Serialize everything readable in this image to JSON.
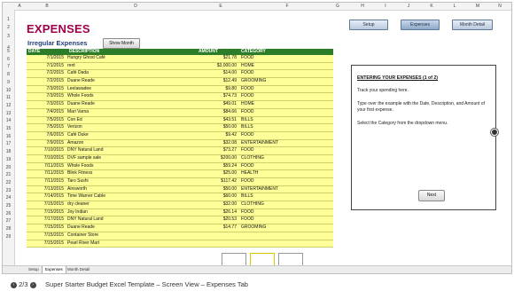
{
  "sheet": {
    "title": "EXPENSES",
    "subtitle": "Irregular Expenses",
    "show_month_button": "Show Month",
    "nav_buttons": [
      {
        "label": "Setup",
        "active": false
      },
      {
        "label": "Expenses",
        "active": true
      },
      {
        "label": "Month Detail",
        "active": false
      }
    ],
    "columns": [
      "A",
      "B",
      "C",
      "D",
      "E",
      "F",
      "G",
      "H",
      "I",
      "J",
      "K",
      "L",
      "M",
      "N"
    ],
    "rows": [
      "1",
      "2",
      "3",
      "4",
      "5",
      "6",
      "7",
      "8",
      "9",
      "10",
      "11",
      "12",
      "13",
      "14",
      "15",
      "16",
      "17",
      "18",
      "19",
      "20",
      "21",
      "22",
      "23",
      "24",
      "25",
      "26",
      "27",
      "28",
      "29"
    ],
    "table_headers": {
      "date": "DATE",
      "description": "DESCRIPTION",
      "amount": "AMOUNT",
      "category": "CATEGORY"
    },
    "expenses": [
      {
        "date": "7/1/2015",
        "description": "Hungry Ghost Café",
        "amount": "$21.78",
        "category": "FOOD"
      },
      {
        "date": "7/1/2015",
        "description": "rent",
        "amount": "$3,000.00",
        "category": "HOME"
      },
      {
        "date": "7/2/2015",
        "description": "Café Dada",
        "amount": "$14.00",
        "category": "FOOD"
      },
      {
        "date": "7/2/2015",
        "description": "Duane Reade",
        "amount": "$12.49",
        "category": "GROOMING"
      },
      {
        "date": "7/3/2015",
        "description": "Leelawadee",
        "amount": "$9.80",
        "category": "FOOD"
      },
      {
        "date": "7/3/2015",
        "description": "Whole Foods",
        "amount": "$74.73",
        "category": "FOOD"
      },
      {
        "date": "7/3/2015",
        "description": "Duane Reade",
        "amount": "$49.01",
        "category": "HOME"
      },
      {
        "date": "7/4/2015",
        "description": "Mari Varna",
        "amount": "$84.66",
        "category": "FOOD"
      },
      {
        "date": "7/5/2015",
        "description": "Con Ed",
        "amount": "$43.51",
        "category": "BILLS"
      },
      {
        "date": "7/5/2015",
        "description": "Verizon",
        "amount": "$50.00",
        "category": "BILLS"
      },
      {
        "date": "7/6/2015",
        "description": "Café Duke",
        "amount": "$9.42",
        "category": "FOOD"
      },
      {
        "date": "7/9/2015",
        "description": "Amazon",
        "amount": "$32.08",
        "category": "ENTERTAINMENT"
      },
      {
        "date": "7/10/2015",
        "description": "DNY Natural Land",
        "amount": "$73.27",
        "category": "FOOD"
      },
      {
        "date": "7/10/2015",
        "description": "DVF sample sale",
        "amount": "$200.00",
        "category": "CLOTHING"
      },
      {
        "date": "7/11/2015",
        "description": "Whole Foods",
        "amount": "$59.24",
        "category": "FOOD"
      },
      {
        "date": "7/11/2015",
        "description": "Blink Fitness",
        "amount": "$25.00",
        "category": "HEALTH"
      },
      {
        "date": "7/11/2015",
        "description": "Taro Sushi",
        "amount": "$117.42",
        "category": "FOOD"
      },
      {
        "date": "7/13/2015",
        "description": "Ainsworth",
        "amount": "$50.00",
        "category": "ENTERTAINMENT"
      },
      {
        "date": "7/14/2015",
        "description": "Time Warner Cable",
        "amount": "$60.00",
        "category": "BILLS"
      },
      {
        "date": "7/15/2015",
        "description": "dry cleaner",
        "amount": "$32.00",
        "category": "CLOTHING"
      },
      {
        "date": "7/15/2015",
        "description": "Joy Indian",
        "amount": "$26.14",
        "category": "FOOD"
      },
      {
        "date": "7/17/2015",
        "description": "DNY Natural Land",
        "amount": "$20.53",
        "category": "FOOD"
      },
      {
        "date": "7/15/2015",
        "description": "Duane Reade",
        "amount": "$14.77",
        "category": "GROOMING"
      },
      {
        "date": "7/15/2015",
        "description": "Container Store",
        "amount": "",
        "category": ""
      },
      {
        "date": "7/15/2015",
        "description": "Pearl River Mart",
        "amount": "",
        "category": ""
      }
    ],
    "panel": {
      "heading": "ENTERING YOUR EXPENSES (1 of 2)",
      "p1": "Track your spending here.",
      "p2": "Type over the example with the Date, Description, and Amount of your first expense.",
      "p3": "Select the Category from the dropdown menu.",
      "next_label": "Next"
    },
    "sheet_tabs": [
      {
        "label": "Setup",
        "active": false
      },
      {
        "label": "Expenses",
        "active": true
      },
      {
        "label": "Month Detail",
        "active": false
      }
    ]
  },
  "caption": {
    "counter": "2/3",
    "text": "Super Starter Budget Excel Template – Screen View – Expenses Tab"
  }
}
